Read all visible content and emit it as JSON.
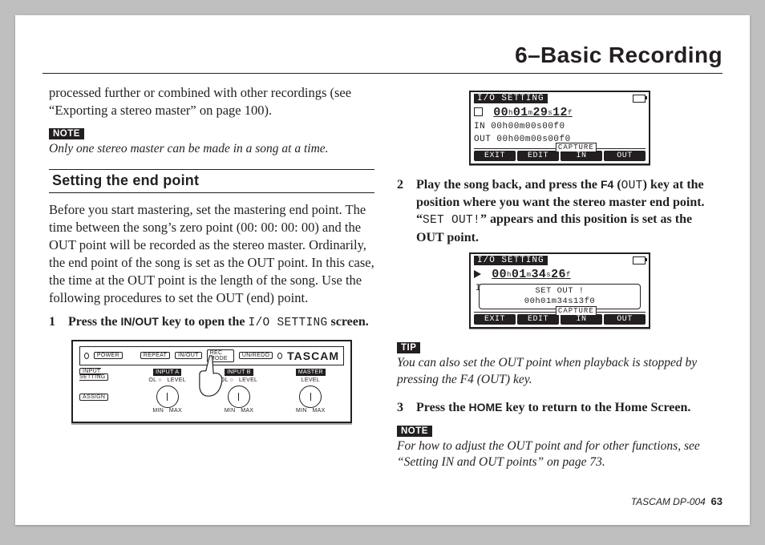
{
  "chapter_title": "6–Basic Recording",
  "col1": {
    "intro": "processed further or combined with other recordings (see “Exporting a stereo master” on page 100).",
    "note_label": "NOTE",
    "note_body": "Only one stereo master can be made in a song at a time.",
    "section_title": "Setting the end point",
    "section_body": "Before you start mastering, set the mastering end point. The time between the song’s zero point (00: 00: 00: 00) and the OUT point will be recorded as the stereo master. Ordinarily, the end point of the song is set as the OUT point. In this case, the time at the OUT point is the length of the song. Use the following procedures to set the OUT (end) point.",
    "step1_num": "1",
    "step1_a": "Press the",
    "step1_b": "IN/OUT",
    "step1_c": "key to open the",
    "step1_d": "I/O SETTING",
    "step1_e": "screen."
  },
  "device": {
    "power": "POWER",
    "repeat": "REPEAT",
    "inout": "IN/OUT",
    "locate": "REC MODE",
    "undo": "UN/REDO",
    "logo": "TASCAM",
    "row_left_1": "INPUT SETTING",
    "row_left_2": "ASSIGN",
    "in_a": "INPUT A",
    "in_b": "INPUT B",
    "master": "MASTER",
    "level": "LEVEL",
    "ol": "OL",
    "min": "MIN",
    "max": "MAX"
  },
  "lcd1": {
    "title": "I/O SETTING",
    "time": "00₀ₕ 01ₘ 29ₛ 12ₑ",
    "time_h": "00",
    "time_m": "01",
    "time_s": "29",
    "time_f": "12",
    "in": "IN   00h00m00s00f0",
    "out": "OUT  00h00m00s00f0",
    "capture": "CAPTURE",
    "btns": [
      "EXIT",
      "EDIT",
      "IN",
      "OUT"
    ]
  },
  "col2": {
    "step2_num": "2",
    "step2_a": "Play the song back, and press the",
    "step2_b": "F4",
    "step2_c": "(",
    "step2_d": "OUT",
    "step2_e": ") key at the position where you want the stereo master end point. “",
    "step2_f": "SET OUT!",
    "step2_g": "” appears and this position is set as the OUT point."
  },
  "lcd2": {
    "title": "I/O SETTING",
    "time_h": "00",
    "time_m": "01",
    "time_s": "34",
    "time_f": "26",
    "popup_line1": "SET OUT !",
    "popup_line2": "00h01m34s13f0",
    "capture": "CAPTURE",
    "btns": [
      "EXIT",
      "EDIT",
      "IN",
      "OUT"
    ]
  },
  "tip_label": "TIP",
  "tip_body": "You can also set the OUT point when playback is stopped by pressing the F4 (OUT) key.",
  "step3_num": "3",
  "step3_a": "Press the",
  "step3_b": "HOME",
  "step3_c": "key to return to the Home Screen.",
  "note2_label": "NOTE",
  "note2_body": "For how to adjust the OUT point and for other functions, see “Setting IN and OUT points” on page 73.",
  "footer_brand": "TASCAM  DP-004",
  "footer_page": "63"
}
